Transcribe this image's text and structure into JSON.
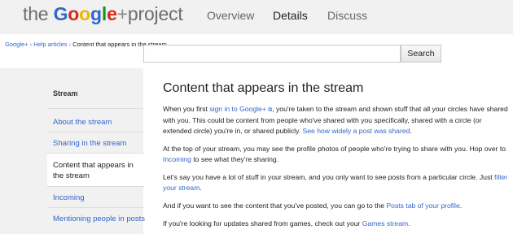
{
  "header": {
    "logo": {
      "the": "the ",
      "google": "Google",
      "plus": "+",
      "project": "project"
    },
    "nav": [
      "Overview",
      "Details",
      "Discuss"
    ]
  },
  "breadcrumb": {
    "items": [
      "Google+",
      "Help articles"
    ],
    "current": "Content that appears in the stream",
    "separator": "›"
  },
  "search": {
    "placeholder": "",
    "button": "Search"
  },
  "sidebar": {
    "heading": "Stream",
    "items": [
      "About the stream",
      "Sharing in the stream",
      "Content that appears in the stream",
      "Incoming",
      "Mentioning people in posts"
    ],
    "selected_index": 2
  },
  "article": {
    "title": "Content that appears in the stream",
    "p1": {
      "t1": "When you first ",
      "link1": "sign in to Google+",
      "t2": ", you're taken to the stream and shown stuff that all your circles have shared with you. This could be content from people who've shared with you specifically, shared with a circle (or extended circle) you're in, or shared publicly. ",
      "link2": "See how widely a post was shared",
      "t3": "."
    },
    "p2": {
      "t1": "At the top of your stream, you may see the profile photos of people who're trying to share with you. Hop over to ",
      "link1": "Incoming",
      "t2": " to see what they're sharing."
    },
    "p3": {
      "t1": "Let's say you have a lot of stuff in your stream, and you only want to see posts from a particular circle. Just ",
      "link1": "filter your stream",
      "t2": "."
    },
    "p4": {
      "t1": "And if you want to see the content that you've posted, you can go to the ",
      "link1": "Posts tab of your profile",
      "t2": "."
    },
    "p5": {
      "t1": "If you're looking for updates shared from games, check out your ",
      "link1": "Games stream",
      "t2": "."
    }
  },
  "colors": {
    "link": "#3366cc",
    "header_bg": "#f1f1f1",
    "sidebar_bg": "#f1f1f1"
  }
}
